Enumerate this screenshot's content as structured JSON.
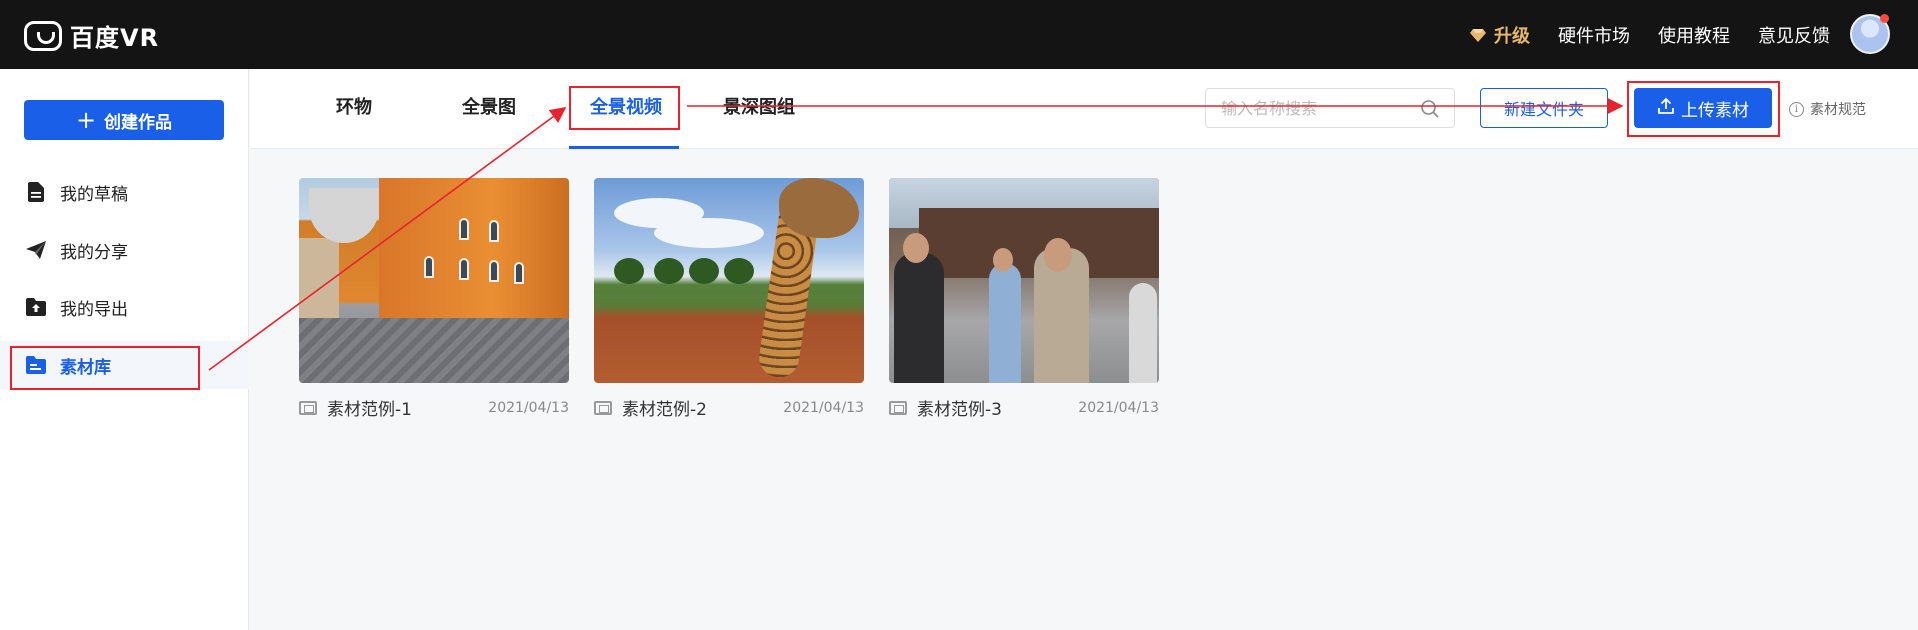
{
  "topbar": {
    "logo_text": "百度VR",
    "upgrade_label": "升级",
    "nav": [
      "硬件市场",
      "使用教程",
      "意见反馈"
    ]
  },
  "sidebar": {
    "create_label": "创建作品",
    "items": [
      {
        "label": "我的草稿",
        "icon": "document-icon"
      },
      {
        "label": "我的分享",
        "icon": "send-icon"
      },
      {
        "label": "我的导出",
        "icon": "export-folder-icon"
      },
      {
        "label": "素材库",
        "icon": "library-icon",
        "active": true
      }
    ]
  },
  "tabs": {
    "items": [
      "环物",
      "全景图",
      "全景视频",
      "景深图组"
    ],
    "active": "全景视频"
  },
  "toolbar": {
    "search_placeholder": "输入名称搜索",
    "new_folder_label": "新建文件夹",
    "upload_label": "上传素材",
    "spec_label": "素材规范"
  },
  "cards": [
    {
      "title": "素材范例-1",
      "date": "2021/04/13"
    },
    {
      "title": "素材范例-2",
      "date": "2021/04/13"
    },
    {
      "title": "素材范例-3",
      "date": "2021/04/13"
    }
  ],
  "colors": {
    "accent": "#1a5fe8",
    "topbar_bg": "#141414",
    "upgrade": "#e8b86a",
    "annotation_red": "#e8232f"
  }
}
